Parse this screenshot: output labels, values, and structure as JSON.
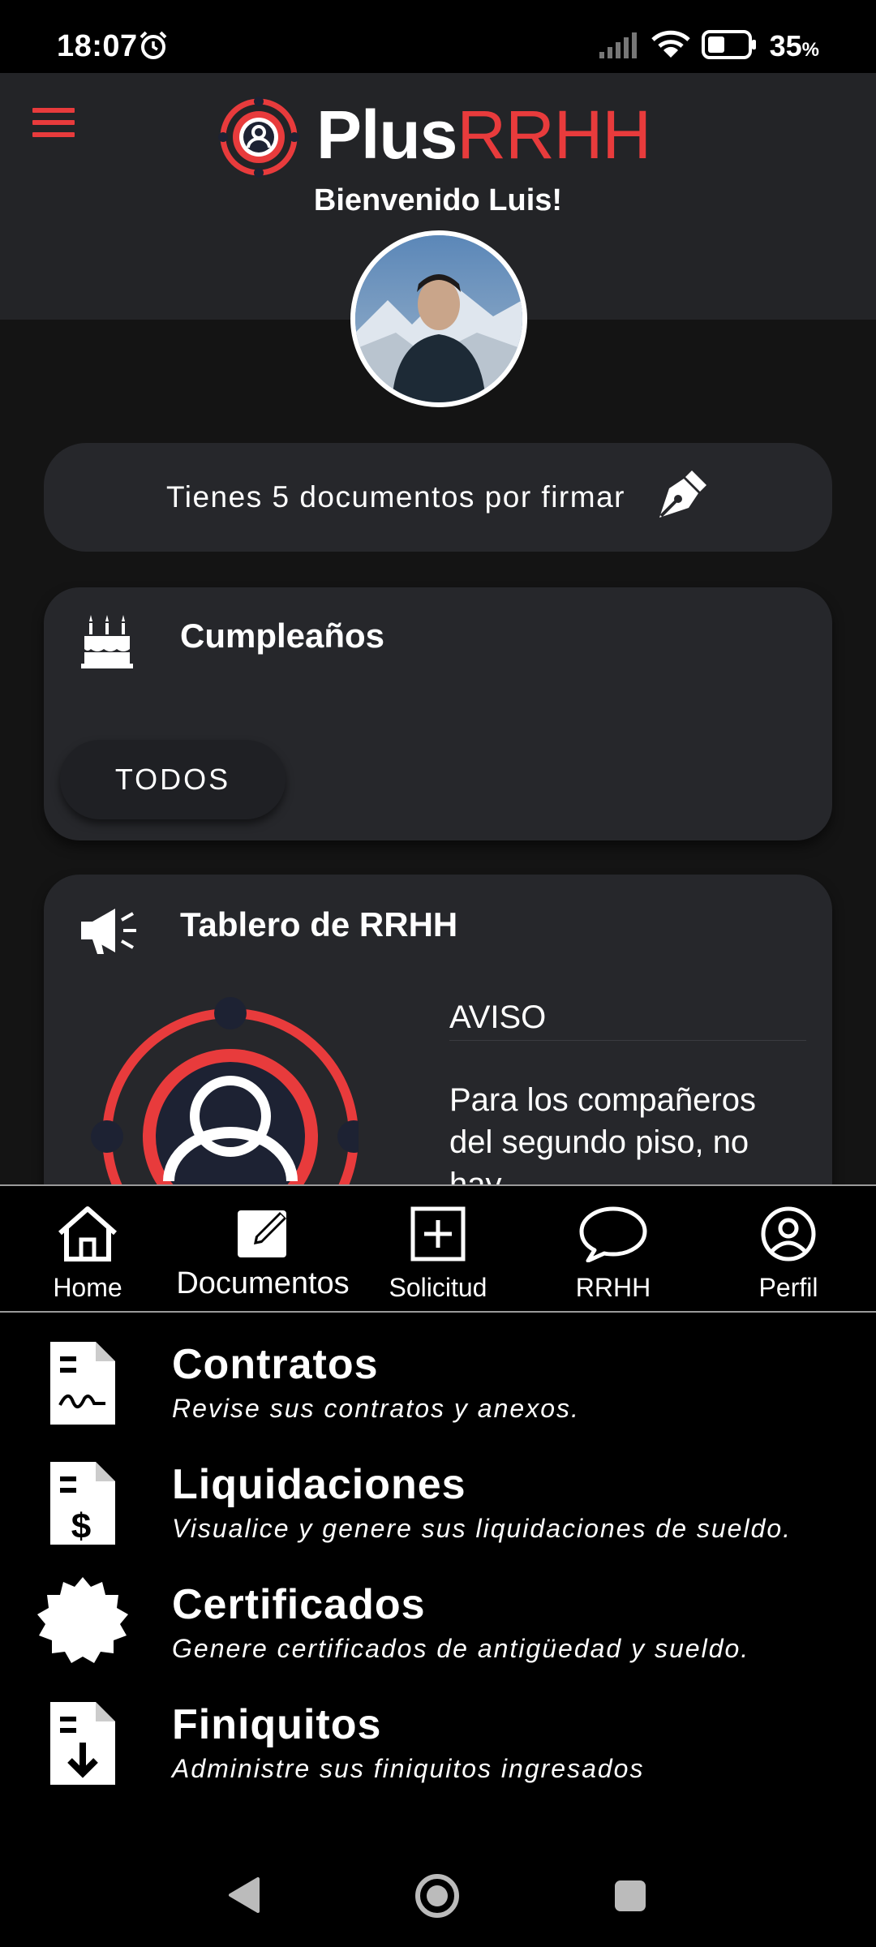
{
  "status_bar": {
    "time": "18:07",
    "battery_percent": "35",
    "battery_suffix": "%",
    "icons": [
      "alarm-icon",
      "signal-icon",
      "wifi-icon",
      "battery-icon"
    ]
  },
  "header": {
    "menu_icon": "hamburger-menu-icon",
    "logo_part1": "Plus",
    "logo_part2": "RRHH",
    "welcome": "Bienvenido Luis!"
  },
  "sign_prompt": {
    "text": "Tienes 5 documentos por firmar",
    "icon": "fountain-pen-icon"
  },
  "birthdays": {
    "title": "Cumpleaños",
    "icon": "cake-icon",
    "button": "TODOS"
  },
  "board": {
    "title": "Tablero de RRHH",
    "icon": "megaphone-icon",
    "notice_title": "AVISO",
    "notice_body": "Para los compañeros del segundo piso, no hay"
  },
  "bottom_nav": {
    "active": "Documentos",
    "items": [
      {
        "label": "Home",
        "icon": "home-icon"
      },
      {
        "label": "Documentos",
        "icon": "edit-document-icon"
      },
      {
        "label": "Solicitud",
        "icon": "plus-square-icon"
      },
      {
        "label": "RRHH",
        "icon": "chat-bubble-icon"
      },
      {
        "label": "Perfil",
        "icon": "user-circle-icon"
      }
    ]
  },
  "documents_menu": [
    {
      "title": "Contratos",
      "subtitle": "Revise sus contratos y anexos.",
      "icon": "contract-document-icon"
    },
    {
      "title": "Liquidaciones",
      "subtitle": "Visualice y genere sus liquidaciones de sueldo.",
      "icon": "payslip-document-icon"
    },
    {
      "title": "Certificados",
      "subtitle": "Genere certificados de antigüedad y sueldo.",
      "icon": "certificate-badge-icon"
    },
    {
      "title": "Finiquitos",
      "subtitle": "Administre sus finiquitos ingresados",
      "icon": "download-document-icon"
    }
  ],
  "colors": {
    "accent": "#e83b3c",
    "header_bg": "#232427",
    "card_bg": "#26272b",
    "page_bg": "#141414"
  }
}
